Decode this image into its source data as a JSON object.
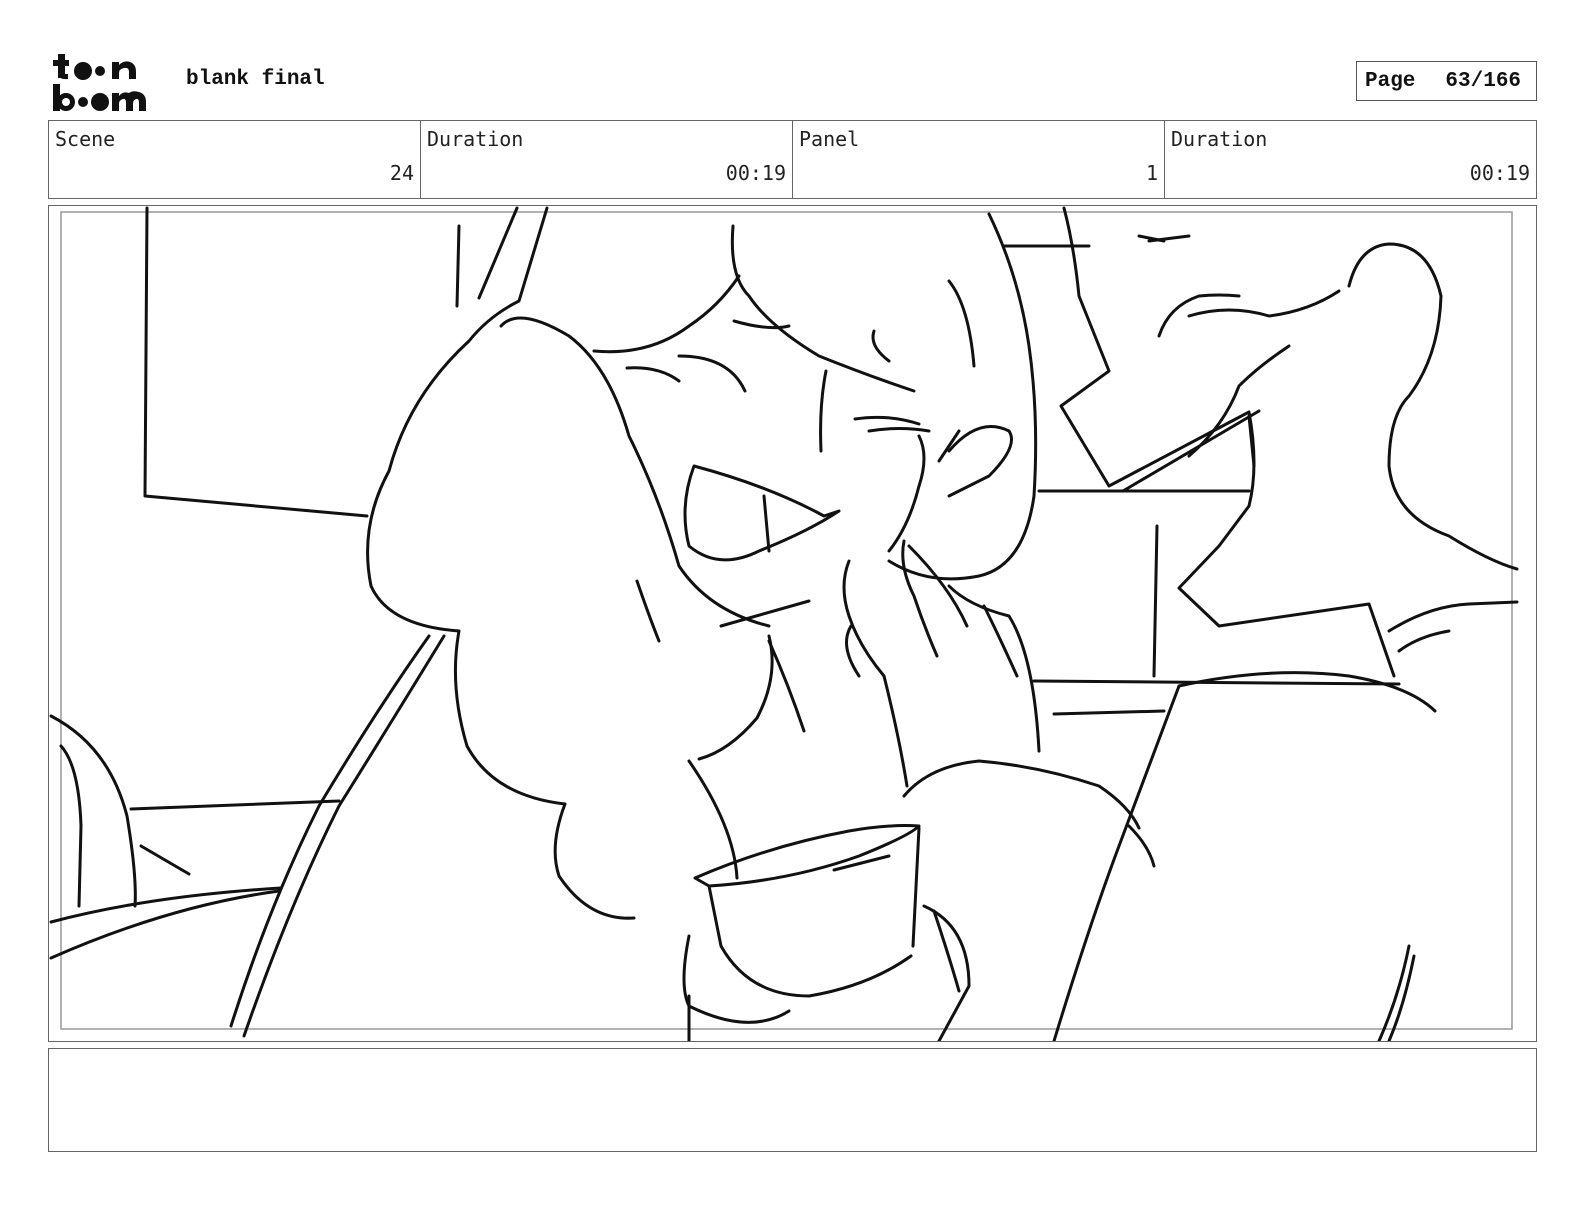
{
  "header": {
    "logo_text": "toon boom",
    "project_title": "blank final",
    "page_label": "Page",
    "page_value": "63/166"
  },
  "info": {
    "scene_label": "Scene",
    "scene_value": "24",
    "duration_label": "Duration",
    "duration_value": "00:19",
    "panel_label": "Panel",
    "panel_value": "1",
    "panel_duration_label": "Duration",
    "panel_duration_value": "00:19"
  },
  "notes": {
    "text": ""
  }
}
